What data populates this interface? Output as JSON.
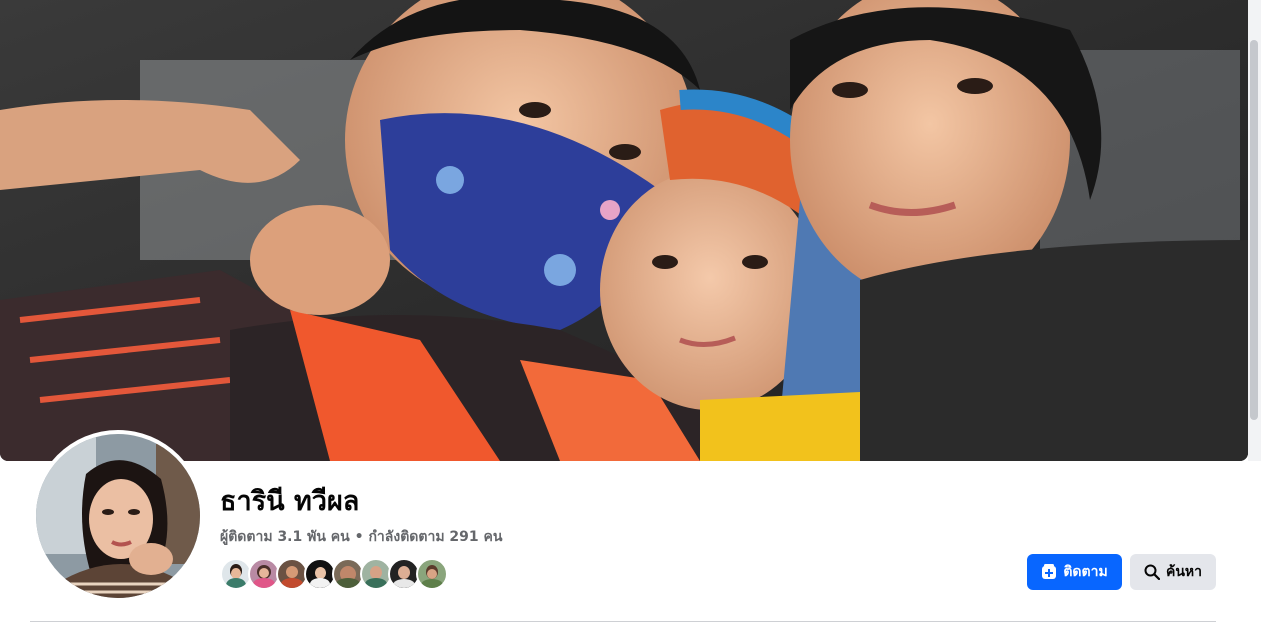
{
  "profile": {
    "name": "ธารินี ทวีผล",
    "followers_text": "ผู้ติดตาม 3.1 พัน คน",
    "separator": " • ",
    "following_text": "กำลังติดตาม 291 คน"
  },
  "actions": {
    "follow_label": "ติดตาม",
    "search_label": "ค้นหา"
  },
  "colors": {
    "primary": "#0866ff",
    "secondary_button": "#e4e6eb"
  },
  "icons": {
    "follow": "follow-plus-icon",
    "search": "search-icon"
  }
}
